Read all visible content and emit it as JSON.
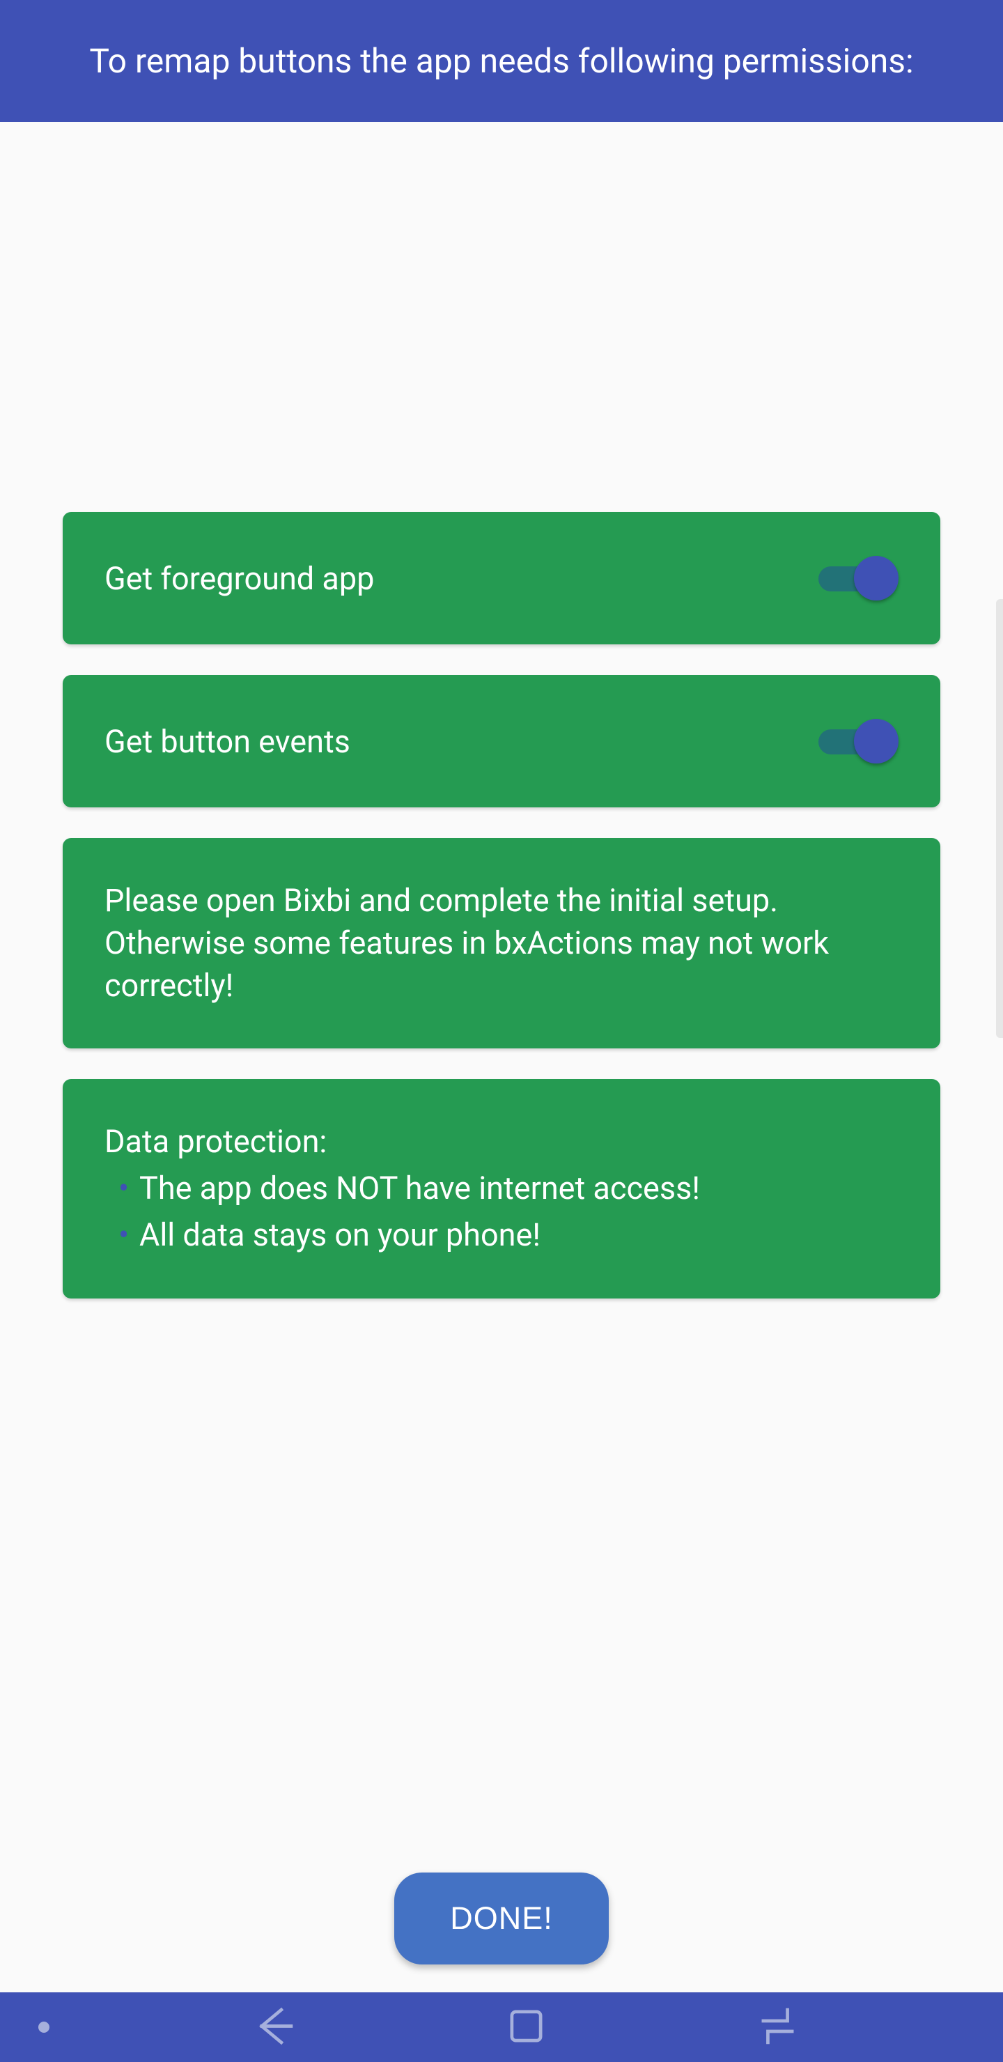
{
  "header": {
    "title": "To remap buttons the app needs following permissions:"
  },
  "permissions": [
    {
      "label": "Get foreground app",
      "enabled": true
    },
    {
      "label": "Get button events",
      "enabled": true
    }
  ],
  "setup_notice": "Please open Bixbi and complete the initial setup. Otherwise some features in bxActions may not work correctly!",
  "data_protection": {
    "title": "Data protection:",
    "bullets": [
      "The app does NOT have internet access!",
      "All data stays on your phone!"
    ]
  },
  "done_label": "DONE!",
  "colors": {
    "primary": "#3f51b5",
    "card": "#259b52",
    "button": "#4472c4"
  }
}
